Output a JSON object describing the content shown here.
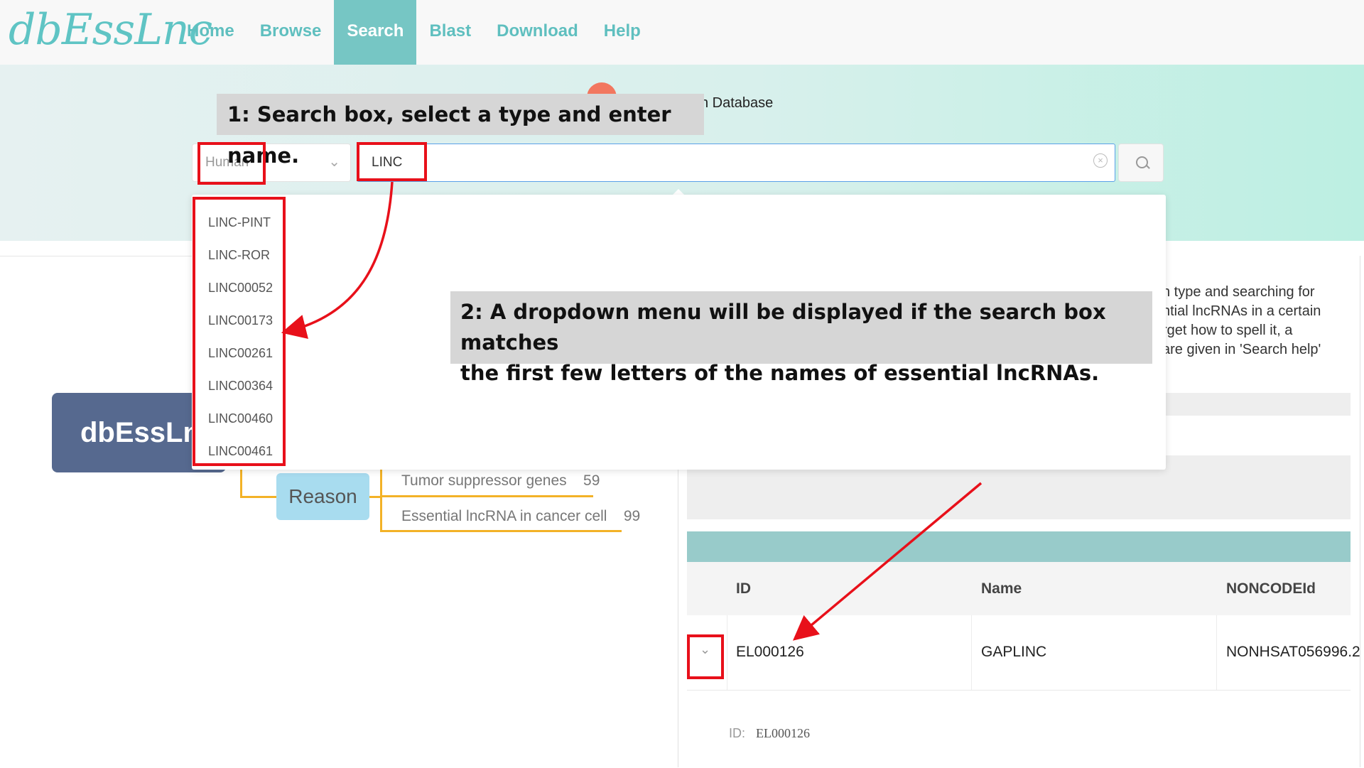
{
  "header": {
    "logo_text": "dbEssLnc",
    "nav": [
      {
        "label": "Home",
        "active": false
      },
      {
        "label": "Browse",
        "active": false
      },
      {
        "label": "Search",
        "active": true
      },
      {
        "label": "Blast",
        "active": false
      },
      {
        "label": "Download",
        "active": false
      },
      {
        "label": "Help",
        "active": false
      }
    ]
  },
  "hero": {
    "subtitle_fragment": "n Database"
  },
  "search": {
    "type_value": "Human",
    "query_value": "LINC",
    "search_icon": "search-icon",
    "clear_icon": "clear-circle-icon"
  },
  "dropdown": {
    "items": [
      "LINC-PINT",
      "LINC-ROR",
      "LINC00052",
      "LINC00173",
      "LINC00261",
      "LINC00364",
      "LINC00460",
      "LINC00461"
    ]
  },
  "annotations": {
    "callout_1": "1: Search box, select a type and enter name.",
    "callout_2_line1": "2: A dropdown menu will be displayed if the search box matches",
    "callout_2_line2": "the first few letters of the names of essential lncRNAs.",
    "highlight_color": "#e8101a"
  },
  "mindmap": {
    "root": "dbEssLnc",
    "reason": "Reason",
    "leaf_1": "Tumor suppressor genes",
    "leaf_1_count": "59",
    "leaf_2": "Essential lncRNA in cancer cell",
    "leaf_2_count": "99"
  },
  "help_text": {
    "line1": "n type and searching for",
    "line2": "ntial lncRNAs in a certain",
    "line3": "rget how to spell it, a",
    "line4": "are given in 'Search help'"
  },
  "results_table": {
    "headers": [
      "ID",
      "Name",
      "NONCODEId"
    ],
    "row": {
      "id": "EL000126",
      "name": "GAPLINC",
      "noncode": "NONHSAT056996.2"
    },
    "detail_label": "ID:",
    "detail_value": "EL000126"
  },
  "colors": {
    "accent": "#76c6c4",
    "nav_text": "#5fbfbf",
    "callout_bg": "#d6d6d6"
  }
}
